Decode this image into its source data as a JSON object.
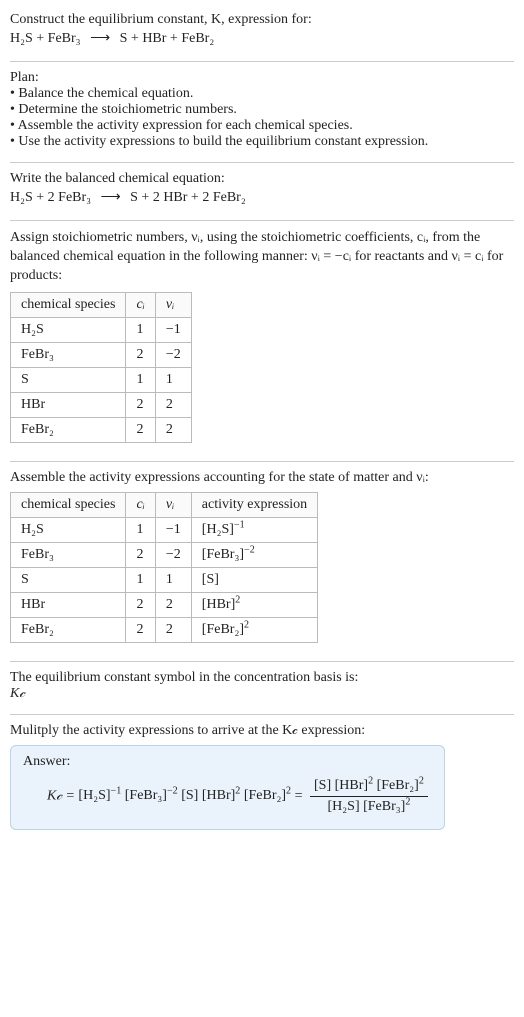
{
  "intro": {
    "line1": "Construct the equilibrium constant, K, expression for:",
    "reaction_lhs": "H₂S + FeBr₃",
    "reaction_arrow": "⟶",
    "reaction_rhs": "S + HBr + FeBr₂"
  },
  "plan": {
    "heading": "Plan:",
    "items": [
      "• Balance the chemical equation.",
      "• Determine the stoichiometric numbers.",
      "• Assemble the activity expression for each chemical species.",
      "• Use the activity expressions to build the equilibrium constant expression."
    ]
  },
  "balanced": {
    "heading": "Write the balanced chemical equation:",
    "lhs": "H₂S + 2 FeBr₃",
    "arrow": "⟶",
    "rhs": "S + 2 HBr + 2 FeBr₂"
  },
  "stoich": {
    "text_a": "Assign stoichiometric numbers, νᵢ, using the stoichiometric coefficients, cᵢ, from the balanced chemical equation in the following manner: νᵢ = −cᵢ for reactants and νᵢ = cᵢ for products:",
    "headers": {
      "species": "chemical species",
      "c": "cᵢ",
      "v": "νᵢ"
    },
    "rows": [
      {
        "species": "H₂S",
        "c": "1",
        "v": "−1"
      },
      {
        "species": "FeBr₃",
        "c": "2",
        "v": "−2"
      },
      {
        "species": "S",
        "c": "1",
        "v": "1"
      },
      {
        "species": "HBr",
        "c": "2",
        "v": "2"
      },
      {
        "species": "FeBr₂",
        "c": "2",
        "v": "2"
      }
    ]
  },
  "activity": {
    "heading": "Assemble the activity expressions accounting for the state of matter and νᵢ:",
    "headers": {
      "species": "chemical species",
      "c": "cᵢ",
      "v": "νᵢ",
      "act": "activity expression"
    },
    "rows": [
      {
        "species": "H₂S",
        "c": "1",
        "v": "−1",
        "expr_base": "[H₂S]",
        "expr_pow": "−1"
      },
      {
        "species": "FeBr₃",
        "c": "2",
        "v": "−2",
        "expr_base": "[FeBr₃]",
        "expr_pow": "−2"
      },
      {
        "species": "S",
        "c": "1",
        "v": "1",
        "expr_base": "[S]",
        "expr_pow": ""
      },
      {
        "species": "HBr",
        "c": "2",
        "v": "2",
        "expr_base": "[HBr]",
        "expr_pow": "2"
      },
      {
        "species": "FeBr₂",
        "c": "2",
        "v": "2",
        "expr_base": "[FeBr₂]",
        "expr_pow": "2"
      }
    ]
  },
  "kc_symbol": {
    "line1": "The equilibrium constant symbol in the concentration basis is:",
    "symbol": "K𝒸"
  },
  "multiply": {
    "heading": "Mulitply the activity expressions to arrive at the K𝒸 expression:"
  },
  "answer": {
    "label": "Answer:",
    "lhs": "K𝒸 = ",
    "prod_terms": [
      {
        "base": "[H₂S]",
        "pow": "−1"
      },
      {
        "base": "[FeBr₃]",
        "pow": "−2"
      },
      {
        "base": "[S]",
        "pow": ""
      },
      {
        "base": "[HBr]",
        "pow": "2"
      },
      {
        "base": "[FeBr₂]",
        "pow": "2"
      }
    ],
    "eq_sign": " = ",
    "frac_num": [
      {
        "base": "[S]",
        "pow": ""
      },
      {
        "base": "[HBr]",
        "pow": "2"
      },
      {
        "base": "[FeBr₂]",
        "pow": "2"
      }
    ],
    "frac_den": [
      {
        "base": "[H₂S]",
        "pow": ""
      },
      {
        "base": "[FeBr₃]",
        "pow": "2"
      }
    ]
  },
  "chart_data": {
    "type": "table",
    "title": "Stoichiometric numbers and activity expressions for H2S + 2 FeBr3 -> S + 2 HBr + 2 FeBr2",
    "columns": [
      "chemical species",
      "c_i",
      "nu_i",
      "activity expression"
    ],
    "rows": [
      [
        "H2S",
        1,
        -1,
        "[H2S]^(-1)"
      ],
      [
        "FeBr3",
        2,
        -2,
        "[FeBr3]^(-2)"
      ],
      [
        "S",
        1,
        1,
        "[S]"
      ],
      [
        "HBr",
        2,
        2,
        "[HBr]^2"
      ],
      [
        "FeBr2",
        2,
        2,
        "[FeBr2]^2"
      ]
    ],
    "result": "Kc = ([S] [HBr]^2 [FeBr2]^2) / ([H2S] [FeBr3]^2)"
  }
}
